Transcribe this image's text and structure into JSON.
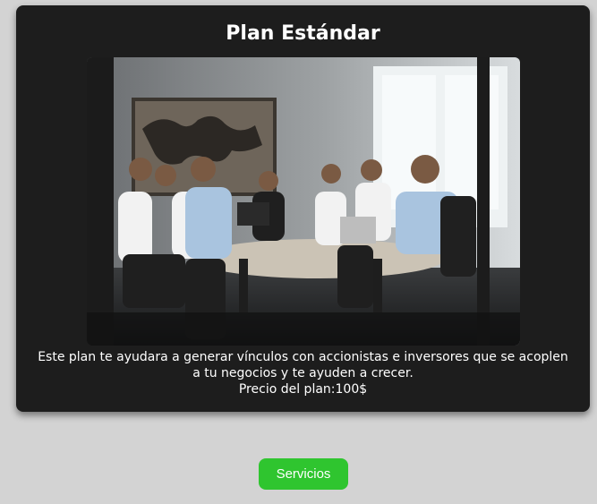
{
  "plan": {
    "title": "Plan Estándar",
    "description": "Este plan te ayudara a generar vínculos con accionistas e inversores que se acoplen a tu negocios y te ayuden a crecer.",
    "price": "Precio del plan:100$"
  },
  "button": {
    "label": "Servicios"
  },
  "colors": {
    "card": "#1d1d1d",
    "page": "#d3d3d3",
    "button": "#2fc52f"
  }
}
